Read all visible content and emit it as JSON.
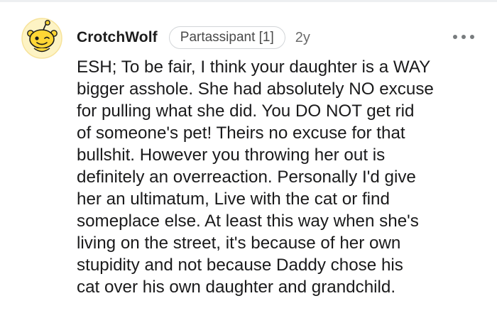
{
  "comment": {
    "author": "CrotchWolf",
    "flair": "Partassipant [1]",
    "age": "2y",
    "body_lines": [
      "ESH; To be fair, I think your daughter is a WAY",
      "bigger asshole. She had absolutely NO excuse",
      "for pulling what she did. You DO NOT get rid",
      "of someone's pet! Theirs no excuse for that",
      "bullshit. However you throwing her out is",
      "definitely an overreaction. Personally I'd give",
      "her an ultimatum, Live with the cat or find",
      "someplace else. At least this way when she's",
      "living on the street, it's because of her own",
      "stupidity and not because Daddy chose his",
      "cat over his own daughter and grandchild."
    ]
  },
  "icons": {
    "avatar": "snoo-avatar-yellow",
    "more": "more-options-icon"
  },
  "colors": {
    "avatar_bg": "#fef6c8",
    "avatar_ring": "#fbe9a0",
    "snoo_yellow": "#ffd635",
    "meta_gray": "#6a6a6a",
    "text": "#1a1a1b"
  }
}
